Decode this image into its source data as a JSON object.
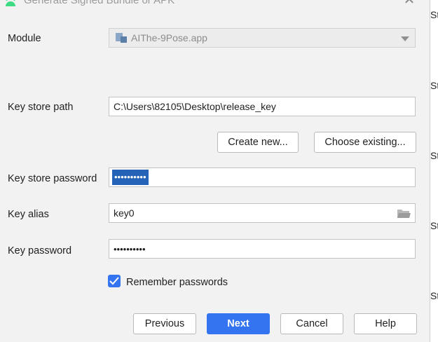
{
  "window": {
    "title": "Generate Signed Bundle or APK",
    "close_symbol": "✕"
  },
  "form": {
    "module_label": "Module",
    "module_value": "AIThe-9Pose.app",
    "keystore_path_label": "Key store path",
    "keystore_path_value": "C:\\Users\\82105\\Desktop\\release_key",
    "keystore_password_label": "Key store password",
    "keystore_password_value": "••••••••••",
    "key_alias_label": "Key alias",
    "key_alias_value": "key0",
    "key_password_label": "Key password",
    "key_password_value": "••••••••••",
    "remember_label": "Remember passwords",
    "remember_checked": true
  },
  "buttons": {
    "create_new": "Create new...",
    "choose_existing": "Choose existing...",
    "previous": "Previous",
    "next": "Next",
    "cancel": "Cancel",
    "help": "Help"
  },
  "side_panel": {
    "items": [
      "St",
      "St",
      "St",
      "St",
      "St"
    ]
  },
  "colors": {
    "accent": "#3574f0",
    "selection": "#2563b8",
    "android_green": "#3ddc84"
  },
  "icons": {
    "android": "android-icon",
    "module": "module-icon",
    "folder": "folder-icon",
    "dropdown": "chevron-down-icon",
    "close": "close-icon",
    "check": "check-icon"
  }
}
